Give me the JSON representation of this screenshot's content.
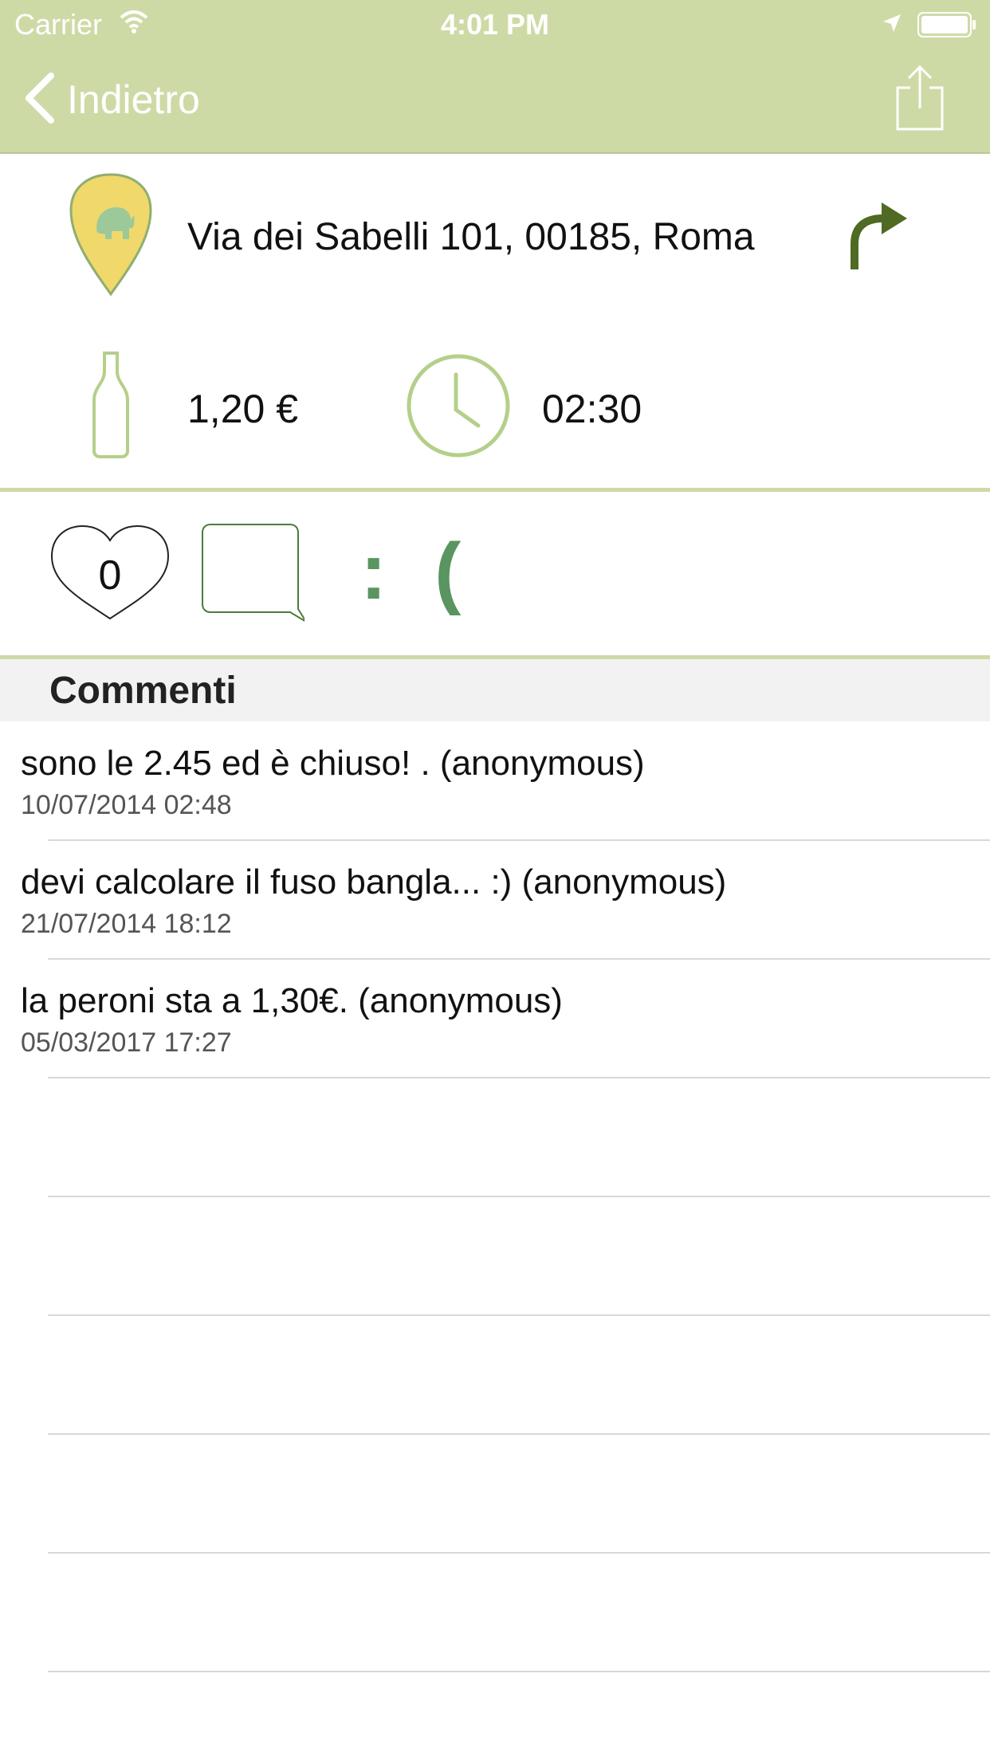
{
  "status_bar": {
    "carrier": "Carrier",
    "time": "4:01 PM"
  },
  "nav": {
    "back_label": "Indietro"
  },
  "place": {
    "address": "Via dei Sabelli 101, 00185, Roma",
    "price": "1,20 €",
    "closing_time": "02:30"
  },
  "actions": {
    "likes": "0",
    "mood": ": ("
  },
  "comments": {
    "title": "Commenti",
    "items": [
      {
        "text": "sono le 2.45 ed è chiuso! . (anonymous)",
        "date": "10/07/2014 02:48"
      },
      {
        "text": "devi calcolare il fuso bangla... :) (anonymous)",
        "date": "21/07/2014 18:12"
      },
      {
        "text": "la peroni sta a 1,30€. (anonymous)",
        "date": "05/03/2017 17:27"
      }
    ]
  },
  "colors": {
    "header_bg": "#cedaa6",
    "accent_green": "#5a9460",
    "dark_green": "#4f6a22",
    "pin_yellow": "#f0d86a"
  },
  "icons": [
    "wifi-icon",
    "location-arrow-icon",
    "battery-icon",
    "chevron-left-icon",
    "share-icon",
    "map-pin-icon",
    "directions-arrow-icon",
    "bottle-icon",
    "clock-icon",
    "heart-icon",
    "comment-bubble-icon"
  ]
}
